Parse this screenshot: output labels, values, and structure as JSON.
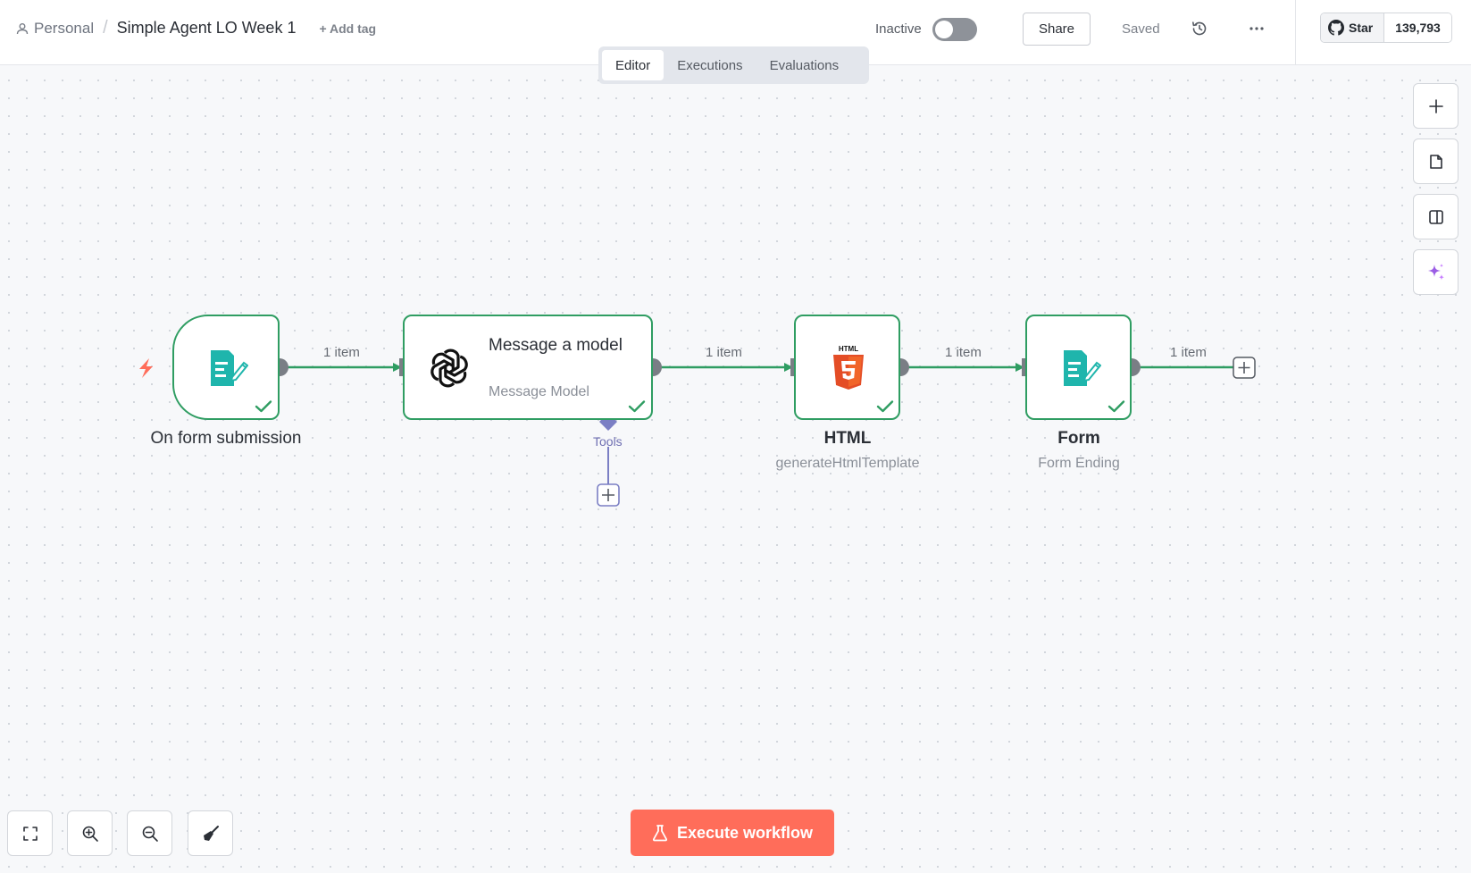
{
  "header": {
    "breadcrumb_personal": "Personal",
    "separator": "/",
    "workflow_title": "Simple Agent LO Week 1",
    "add_tag": "+ Add tag",
    "active_state_label": "Inactive",
    "active": false,
    "share_label": "Share",
    "saved_label": "Saved",
    "github_star_label": "Star",
    "github_star_count": "139,793"
  },
  "tabs": [
    {
      "label": "Editor",
      "active": true
    },
    {
      "label": "Executions",
      "active": false
    },
    {
      "label": "Evaluations",
      "active": false
    }
  ],
  "nodes": {
    "trigger": {
      "title": "On form submission",
      "icon": "form-icon",
      "status": "success"
    },
    "model": {
      "title": "Message a model",
      "subtitle": "Message Model",
      "icon": "openai-icon",
      "status": "success",
      "sub_connector_label": "Tools"
    },
    "html": {
      "title": "HTML",
      "subtitle": "generateHtmlTemplate",
      "icon": "html5-icon",
      "status": "success"
    },
    "form": {
      "title": "Form",
      "subtitle": "Form Ending",
      "icon": "form-icon",
      "status": "success"
    }
  },
  "edges": [
    {
      "label": "1 item"
    },
    {
      "label": "1 item"
    },
    {
      "label": "1 item"
    },
    {
      "label": "1 item"
    }
  ],
  "execute_button_label": "Execute workflow",
  "colors": {
    "success": "#2f9d62",
    "accent": "#ff6d5a",
    "form_icon": "#1fb5ac",
    "html_icon": "#e44d26",
    "tools_connector": "#7b7fc4",
    "ai_icon": "#9b5de5"
  }
}
